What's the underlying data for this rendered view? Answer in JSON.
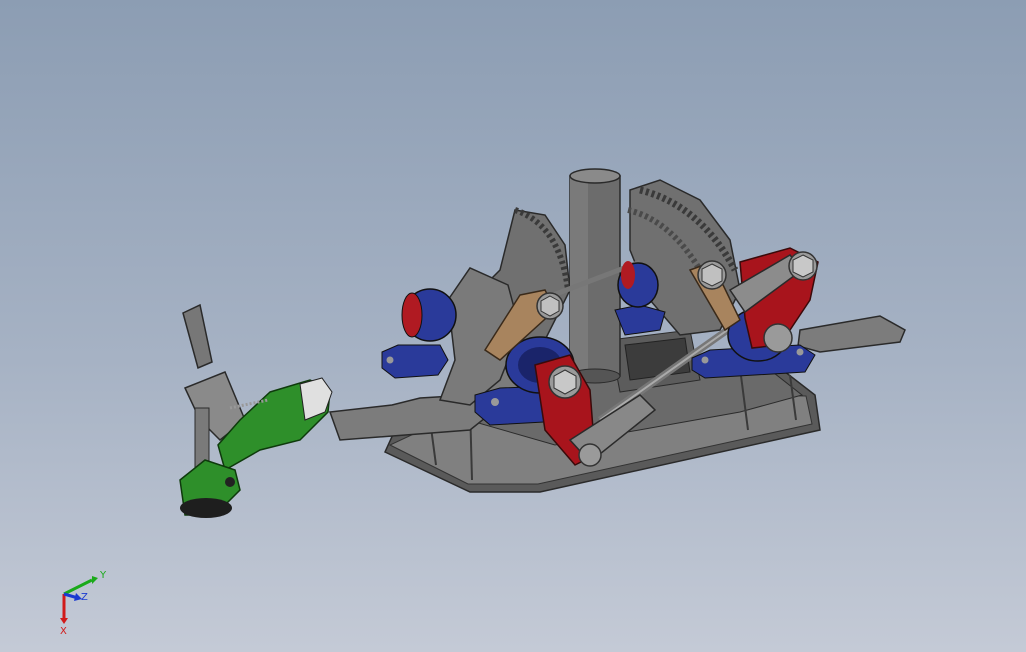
{
  "viewport": {
    "background_top": "#8c9db3",
    "background_bottom": "#c4cad6"
  },
  "colors": {
    "steel": "#6e6e6e",
    "steel_light": "#8a8a8a",
    "steel_dark": "#4a4a4a",
    "bearing_blue": "#2a3a9a",
    "bearing_red": "#b01a22",
    "link_red": "#a8141c",
    "link_bronze": "#a8845e",
    "gripper_green": "#2e8f2a",
    "axis_x": "#d11a1a",
    "axis_y": "#1aaa1a",
    "axis_z": "#1a3ad1"
  },
  "triad": {
    "x_label": "X",
    "y_label": "Y",
    "z_label": "Z"
  }
}
